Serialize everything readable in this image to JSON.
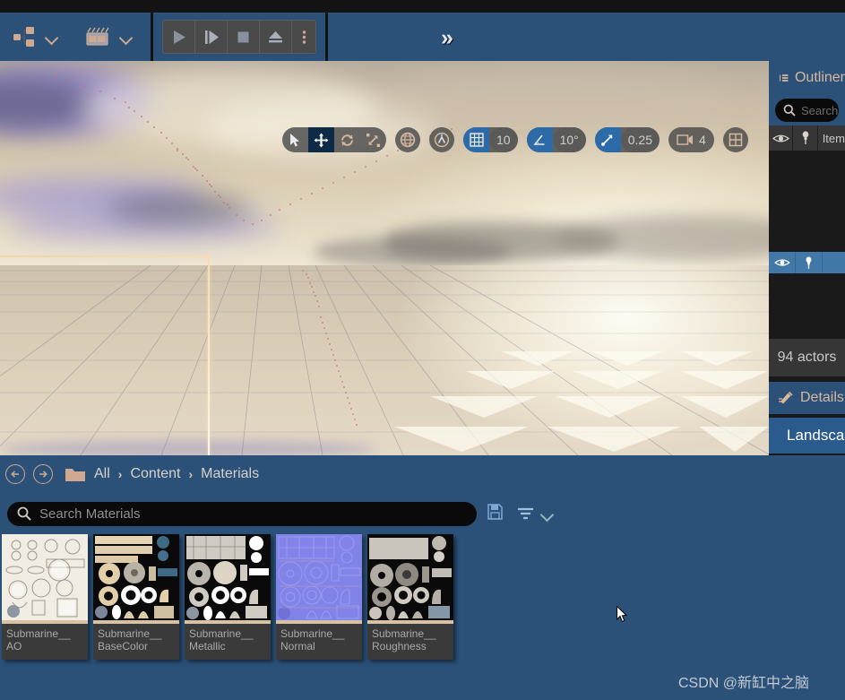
{
  "app": {
    "accent_blue": "#2b5179",
    "panel_dark": "#1a1a1a",
    "tan": "#cfa98f"
  },
  "toolbar": {
    "blueprint_dropdown_label": "blueprint-menu",
    "cinematics_dropdown_label": "cinematics-menu",
    "play_label": "Play",
    "skip_label": "Skip",
    "stop_label": "Stop",
    "eject_label": "Eject",
    "options_label": "Options",
    "overflow_label": "»"
  },
  "viewport_toolbar": {
    "select_tool": "select",
    "move_tool": "move",
    "rotate_tool": "rotate",
    "scale_tool": "scale",
    "coordinate_system": "world",
    "surface_snap": "surface-snapping",
    "grid_snap_enabled": true,
    "grid_snap_value": "10",
    "angle_snap_enabled": true,
    "angle_snap_value": "10°",
    "scale_snap_enabled": true,
    "scale_snap_value": "0.25",
    "camera_speed_value": "4",
    "viewport_layout": "layouts"
  },
  "outliner": {
    "tab_title": "Outliner",
    "search_placeholder": "Search",
    "column_item": "Item",
    "actor_count": "94 actors",
    "details_tab": "Details",
    "selected_actor": "Landscape"
  },
  "breadcrumb": {
    "back_label": "Back",
    "forward_label": "Forward",
    "items": [
      "All",
      "Content",
      "Materials"
    ],
    "separator": "›"
  },
  "content_browser": {
    "search_placeholder": "Search Materials",
    "save_label": "Save Search",
    "filter_label": "Filters",
    "assets": [
      {
        "name_line1": "Submarine__",
        "name_line2": "AO",
        "thumb_style": "ao"
      },
      {
        "name_line1": "Submarine__",
        "name_line2": "BaseColor",
        "thumb_style": "basecolor"
      },
      {
        "name_line1": "Submarine__",
        "name_line2": "Metallic",
        "thumb_style": "metallic"
      },
      {
        "name_line1": "Submarine__",
        "name_line2": "Normal",
        "thumb_style": "normal"
      },
      {
        "name_line1": "Submarine__",
        "name_line2": "Roughness",
        "thumb_style": "roughness"
      }
    ]
  },
  "watermark": {
    "text": "CSDN @新缸中之脑"
  }
}
